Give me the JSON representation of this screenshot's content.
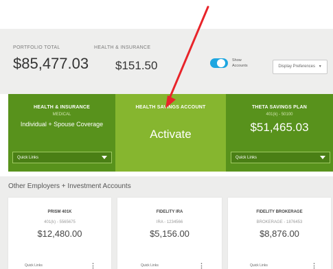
{
  "header": {
    "portfolio_label": "PORTFOLIO TOTAL",
    "portfolio_value": "$85,477.03",
    "health_label": "HEALTH & INSURANCE",
    "health_value": "$151.50",
    "toggle_label_1": "Show",
    "toggle_label_2": "Accounts",
    "display_button": "Display Preferences"
  },
  "cards": [
    {
      "title": "HEALTH & INSURANCE",
      "subtitle": "MEDICAL",
      "line": "Individual + Spouse Coverage",
      "quick_links": "Quick Links"
    },
    {
      "title": "HEALTH SAVINGS ACCOUNT",
      "action": "Activate"
    },
    {
      "title": "THETA SAVINGS PLAN",
      "subtitle": "401(k) - 50100",
      "value": "$51,465.03",
      "quick_links": "Quick Links"
    }
  ],
  "other": {
    "title": "Other Employers + Investment Accounts",
    "accounts": [
      {
        "title": "PRISM 401K",
        "sub": "401(k) - 5565675",
        "value": "$12,480.00",
        "quick": "Quick Links"
      },
      {
        "title": "FIDELITY IRA",
        "sub": "IRA - 1234566",
        "value": "$5,156.00",
        "quick": "Quick Links"
      },
      {
        "title": "FIDELITY BROKERAGE",
        "sub": "BROKERAGE - 1876453",
        "value": "$8,876.00",
        "quick": "Quick Links"
      }
    ]
  },
  "colors": {
    "dark_green": "#58921c",
    "light_green": "#86b62f",
    "toggle_blue": "#1ea6e0",
    "arrow_red": "#e8242a"
  }
}
